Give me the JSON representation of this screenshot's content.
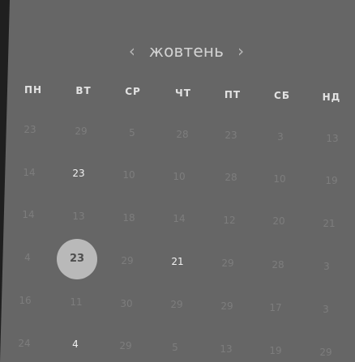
{
  "header": {
    "month": "жовтень",
    "prev_icon": "chevron-left-icon",
    "next_icon": "chevron-right-icon",
    "prev_glyph": "‹",
    "next_glyph": "›"
  },
  "weekdays": [
    "ПН",
    "ВТ",
    "СР",
    "ЧТ",
    "ПТ",
    "СБ",
    "НД"
  ],
  "weeks": [
    {
      "days": [
        "23",
        "29",
        "5",
        "28",
        "23",
        "3",
        "13"
      ]
    },
    {
      "days": [
        "14",
        "23",
        "10",
        "10",
        "28",
        "10",
        "19"
      ]
    },
    {
      "days": [
        "14",
        "13",
        "18",
        "14",
        "12",
        "20",
        "21"
      ]
    },
    {
      "days": [
        "4",
        "23",
        "29",
        "21",
        "29",
        "28",
        "3"
      ]
    },
    {
      "days": [
        "16",
        "11",
        "30",
        "29",
        "29",
        "17",
        "3"
      ]
    },
    {
      "days": [
        "24",
        "4",
        "29",
        "5",
        "13",
        "19",
        "29"
      ]
    }
  ],
  "colors": {
    "panel": "#666666",
    "background": "#1f1f1f",
    "muted_day": "#7d7d7d",
    "active_day": "#f2f2f2",
    "selected_fill": "#b9b9b9"
  }
}
